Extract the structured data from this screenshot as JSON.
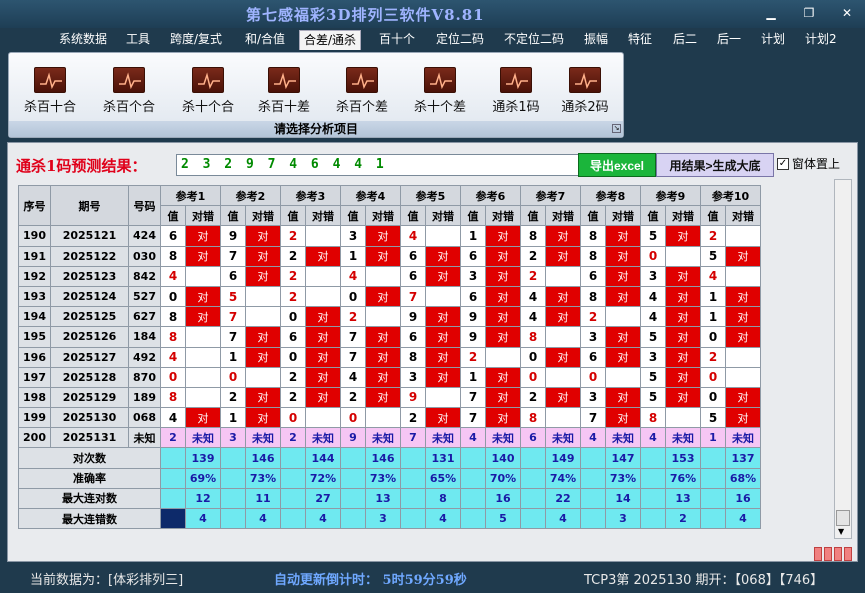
{
  "title": "第七感福彩3D排列三软件V8.81",
  "menu": [
    "系统数据",
    "工具",
    "跨度/复式",
    "和/合值",
    "合差/通杀",
    "百十个",
    "定位二码",
    "不定位二码",
    "振幅",
    "特征",
    "后二",
    "后一",
    "计划",
    "计划2"
  ],
  "menu_active": "合差/通杀",
  "ribbon": {
    "buttons": [
      "杀百十合",
      "杀百个合",
      "杀十个合",
      "杀百十差",
      "杀百个差",
      "杀十个差",
      "通杀1码",
      "通杀2码"
    ],
    "group_label": "请选择分析项目"
  },
  "prediction": {
    "label": "通杀1码预测结果：",
    "value": "2 3 2 9 7 4 6 4 4 1",
    "excel_button": "导出excel",
    "generate_button": "用结果>生成大底",
    "topmost_label": "窗体置上"
  },
  "table": {
    "headers": {
      "seq": "序号",
      "period": "期号",
      "number": "号码",
      "refs": [
        "参考1",
        "参考2",
        "参考3",
        "参考4",
        "参考5",
        "参考6",
        "参考7",
        "参考8",
        "参考9",
        "参考10"
      ],
      "sub_value": "值",
      "sub_result": "对错"
    },
    "rows": [
      {
        "seq": "190",
        "period": "2025121",
        "number": "424",
        "cells": [
          {
            "v": "6",
            "c": "blk",
            "r": "对"
          },
          {
            "v": "9",
            "c": "blk",
            "r": "对"
          },
          {
            "v": "2",
            "c": "red",
            "r": ""
          },
          {
            "v": "3",
            "c": "blk",
            "r": "对"
          },
          {
            "v": "4",
            "c": "red",
            "r": ""
          },
          {
            "v": "1",
            "c": "blk",
            "r": "对"
          },
          {
            "v": "8",
            "c": "blk",
            "r": "对"
          },
          {
            "v": "8",
            "c": "blk",
            "r": "对"
          },
          {
            "v": "5",
            "c": "blk",
            "r": "对"
          },
          {
            "v": "2",
            "c": "red",
            "r": ""
          }
        ]
      },
      {
        "seq": "191",
        "period": "2025122",
        "number": "030",
        "cells": [
          {
            "v": "8",
            "c": "blk",
            "r": "对"
          },
          {
            "v": "7",
            "c": "blk",
            "r": "对"
          },
          {
            "v": "2",
            "c": "blk",
            "r": "对"
          },
          {
            "v": "1",
            "c": "blk",
            "r": "对"
          },
          {
            "v": "6",
            "c": "blk",
            "r": "对"
          },
          {
            "v": "6",
            "c": "blk",
            "r": "对"
          },
          {
            "v": "2",
            "c": "blk",
            "r": "对"
          },
          {
            "v": "8",
            "c": "blk",
            "r": "对"
          },
          {
            "v": "0",
            "c": "red",
            "r": ""
          },
          {
            "v": "5",
            "c": "blk",
            "r": "对"
          }
        ]
      },
      {
        "seq": "192",
        "period": "2025123",
        "number": "842",
        "cells": [
          {
            "v": "4",
            "c": "red",
            "r": ""
          },
          {
            "v": "6",
            "c": "blk",
            "r": "对"
          },
          {
            "v": "2",
            "c": "red",
            "r": ""
          },
          {
            "v": "4",
            "c": "red",
            "r": ""
          },
          {
            "v": "6",
            "c": "blk",
            "r": "对"
          },
          {
            "v": "3",
            "c": "blk",
            "r": "对"
          },
          {
            "v": "2",
            "c": "red",
            "r": ""
          },
          {
            "v": "6",
            "c": "blk",
            "r": "对"
          },
          {
            "v": "3",
            "c": "blk",
            "r": "对"
          },
          {
            "v": "4",
            "c": "red",
            "r": ""
          }
        ]
      },
      {
        "seq": "193",
        "period": "2025124",
        "number": "527",
        "cells": [
          {
            "v": "0",
            "c": "blk",
            "r": "对"
          },
          {
            "v": "5",
            "c": "red",
            "r": ""
          },
          {
            "v": "2",
            "c": "red",
            "r": ""
          },
          {
            "v": "0",
            "c": "blk",
            "r": "对"
          },
          {
            "v": "7",
            "c": "red",
            "r": ""
          },
          {
            "v": "6",
            "c": "blk",
            "r": "对"
          },
          {
            "v": "4",
            "c": "blk",
            "r": "对"
          },
          {
            "v": "8",
            "c": "blk",
            "r": "对"
          },
          {
            "v": "4",
            "c": "blk",
            "r": "对"
          },
          {
            "v": "1",
            "c": "blk",
            "r": "对"
          }
        ]
      },
      {
        "seq": "194",
        "period": "2025125",
        "number": "627",
        "cells": [
          {
            "v": "8",
            "c": "blk",
            "r": "对"
          },
          {
            "v": "7",
            "c": "red",
            "r": ""
          },
          {
            "v": "0",
            "c": "blk",
            "r": "对"
          },
          {
            "v": "2",
            "c": "red",
            "r": ""
          },
          {
            "v": "9",
            "c": "blk",
            "r": "对"
          },
          {
            "v": "9",
            "c": "blk",
            "r": "对"
          },
          {
            "v": "4",
            "c": "blk",
            "r": "对"
          },
          {
            "v": "2",
            "c": "red",
            "r": ""
          },
          {
            "v": "4",
            "c": "blk",
            "r": "对"
          },
          {
            "v": "1",
            "c": "blk",
            "r": "对"
          }
        ]
      },
      {
        "seq": "195",
        "period": "2025126",
        "number": "184",
        "cells": [
          {
            "v": "8",
            "c": "red",
            "r": ""
          },
          {
            "v": "7",
            "c": "blk",
            "r": "对"
          },
          {
            "v": "6",
            "c": "blk",
            "r": "对"
          },
          {
            "v": "7",
            "c": "blk",
            "r": "对"
          },
          {
            "v": "6",
            "c": "blk",
            "r": "对"
          },
          {
            "v": "9",
            "c": "blk",
            "r": "对"
          },
          {
            "v": "8",
            "c": "red",
            "r": ""
          },
          {
            "v": "3",
            "c": "blk",
            "r": "对"
          },
          {
            "v": "5",
            "c": "blk",
            "r": "对"
          },
          {
            "v": "0",
            "c": "blk",
            "r": "对"
          }
        ]
      },
      {
        "seq": "196",
        "period": "2025127",
        "number": "492",
        "cells": [
          {
            "v": "4",
            "c": "red",
            "r": ""
          },
          {
            "v": "1",
            "c": "blk",
            "r": "对"
          },
          {
            "v": "0",
            "c": "blk",
            "r": "对"
          },
          {
            "v": "7",
            "c": "blk",
            "r": "对"
          },
          {
            "v": "8",
            "c": "blk",
            "r": "对"
          },
          {
            "v": "2",
            "c": "red",
            "r": ""
          },
          {
            "v": "0",
            "c": "blk",
            "r": "对"
          },
          {
            "v": "6",
            "c": "blk",
            "r": "对"
          },
          {
            "v": "3",
            "c": "blk",
            "r": "对"
          },
          {
            "v": "2",
            "c": "red",
            "r": ""
          }
        ]
      },
      {
        "seq": "197",
        "period": "2025128",
        "number": "870",
        "cells": [
          {
            "v": "0",
            "c": "red",
            "r": ""
          },
          {
            "v": "0",
            "c": "red",
            "r": ""
          },
          {
            "v": "2",
            "c": "blk",
            "r": "对"
          },
          {
            "v": "4",
            "c": "blk",
            "r": "对"
          },
          {
            "v": "3",
            "c": "blk",
            "r": "对"
          },
          {
            "v": "1",
            "c": "blk",
            "r": "对"
          },
          {
            "v": "0",
            "c": "red",
            "r": ""
          },
          {
            "v": "0",
            "c": "red",
            "r": ""
          },
          {
            "v": "5",
            "c": "blk",
            "r": "对"
          },
          {
            "v": "0",
            "c": "red",
            "r": ""
          }
        ]
      },
      {
        "seq": "198",
        "period": "2025129",
        "number": "189",
        "cells": [
          {
            "v": "8",
            "c": "red",
            "r": ""
          },
          {
            "v": "2",
            "c": "blk",
            "r": "对"
          },
          {
            "v": "2",
            "c": "blk",
            "r": "对"
          },
          {
            "v": "2",
            "c": "blk",
            "r": "对"
          },
          {
            "v": "9",
            "c": "red",
            "r": ""
          },
          {
            "v": "7",
            "c": "blk",
            "r": "对"
          },
          {
            "v": "2",
            "c": "blk",
            "r": "对"
          },
          {
            "v": "3",
            "c": "blk",
            "r": "对"
          },
          {
            "v": "5",
            "c": "blk",
            "r": "对"
          },
          {
            "v": "0",
            "c": "blk",
            "r": "对"
          }
        ]
      },
      {
        "seq": "199",
        "period": "2025130",
        "number": "068",
        "cells": [
          {
            "v": "4",
            "c": "blk",
            "r": "对"
          },
          {
            "v": "1",
            "c": "blk",
            "r": "对"
          },
          {
            "v": "0",
            "c": "red",
            "r": ""
          },
          {
            "v": "0",
            "c": "red",
            "r": ""
          },
          {
            "v": "2",
            "c": "blk",
            "r": "对"
          },
          {
            "v": "7",
            "c": "blk",
            "r": "对"
          },
          {
            "v": "8",
            "c": "red",
            "r": ""
          },
          {
            "v": "7",
            "c": "blk",
            "r": "对"
          },
          {
            "v": "8",
            "c": "red",
            "r": ""
          },
          {
            "v": "5",
            "c": "blk",
            "r": "对"
          }
        ]
      }
    ],
    "predict_row": {
      "seq": "200",
      "period": "2025131",
      "number": "未知",
      "cells": [
        {
          "v": "2",
          "r": "未知"
        },
        {
          "v": "3",
          "r": "未知"
        },
        {
          "v": "2",
          "r": "未知"
        },
        {
          "v": "9",
          "r": "未知"
        },
        {
          "v": "7",
          "r": "未知"
        },
        {
          "v": "4",
          "r": "未知"
        },
        {
          "v": "6",
          "r": "未知"
        },
        {
          "v": "4",
          "r": "未知"
        },
        {
          "v": "4",
          "r": "未知"
        },
        {
          "v": "1",
          "r": "未知"
        }
      ]
    },
    "stats": [
      {
        "label": "对次数",
        "values": [
          "139",
          "146",
          "144",
          "146",
          "131",
          "140",
          "149",
          "147",
          "153",
          "137"
        ]
      },
      {
        "label": "准确率",
        "values": [
          "69%",
          "73%",
          "72%",
          "73%",
          "65%",
          "70%",
          "74%",
          "73%",
          "76%",
          "68%"
        ]
      },
      {
        "label": "最大连对数",
        "values": [
          "12",
          "11",
          "27",
          "13",
          "8",
          "16",
          "22",
          "14",
          "13",
          "16"
        ]
      },
      {
        "label": "最大连错数",
        "values": [
          "4",
          "4",
          "4",
          "3",
          "4",
          "5",
          "4",
          "3",
          "2",
          "4"
        ]
      }
    ]
  },
  "status": {
    "current_data": "当前数据为：[体彩排列三]",
    "countdown": "自动更新倒计时：  5时59分59秒",
    "tcp": "TCP3第  2025130  期开：【068】【746】"
  },
  "colors": {
    "hit": "#e00000",
    "predict_row": "#f6c6f4",
    "stat_row": "#6fe9f0",
    "excel": "#1bb53b"
  }
}
